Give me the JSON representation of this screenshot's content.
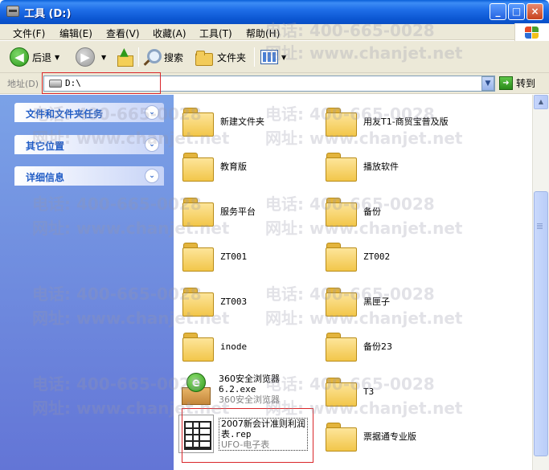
{
  "window": {
    "title": "工具 (D:)",
    "controls": {
      "minimize": "_",
      "maximize": "□",
      "close": "×"
    }
  },
  "menu": {
    "items": [
      "文件(F)",
      "编辑(E)",
      "查看(V)",
      "收藏(A)",
      "工具(T)",
      "帮助(H)"
    ]
  },
  "toolbar": {
    "back": "后退",
    "search": "搜索",
    "folders": "文件夹"
  },
  "address": {
    "label": "地址(D)",
    "value": "D:\\",
    "go": "转到"
  },
  "taskpane": {
    "panels": [
      "文件和文件夹任务",
      "其它位置",
      "详细信息"
    ]
  },
  "files": [
    {
      "name": "新建文件夹",
      "type": "folder"
    },
    {
      "name": "用友T1-商贸宝普及版",
      "type": "folder"
    },
    {
      "name": "教育版",
      "type": "folder"
    },
    {
      "name": "播放软件",
      "type": "folder"
    },
    {
      "name": "服务平台",
      "type": "folder"
    },
    {
      "name": "备份",
      "type": "folder"
    },
    {
      "name": "ZT001",
      "type": "folder"
    },
    {
      "name": "ZT002",
      "type": "folder"
    },
    {
      "name": "ZT003",
      "type": "folder"
    },
    {
      "name": "黑匣子",
      "type": "folder"
    },
    {
      "name": "inode",
      "type": "folder"
    },
    {
      "name": "备份23",
      "type": "folder"
    },
    {
      "name": "360安全浏览器",
      "name2": "6.2.exe",
      "sub": "360安全浏览器",
      "type": "exe"
    },
    {
      "name": "T3",
      "type": "folder"
    },
    {
      "name": "2007新会计准则利润",
      "name2": "表.rep",
      "sub": "UFO-电子表",
      "type": "rep"
    },
    {
      "name": "票据通专业版",
      "type": "folder"
    }
  ],
  "watermark": {
    "phone": "电话: 400-665-0028",
    "site": "网址: www.chanjet.net"
  },
  "colors": {
    "titlebar": "#0b56d1",
    "taskpane": "#6f8ce0",
    "panel_title": "#215dc6",
    "highlight": "#d9262a"
  }
}
